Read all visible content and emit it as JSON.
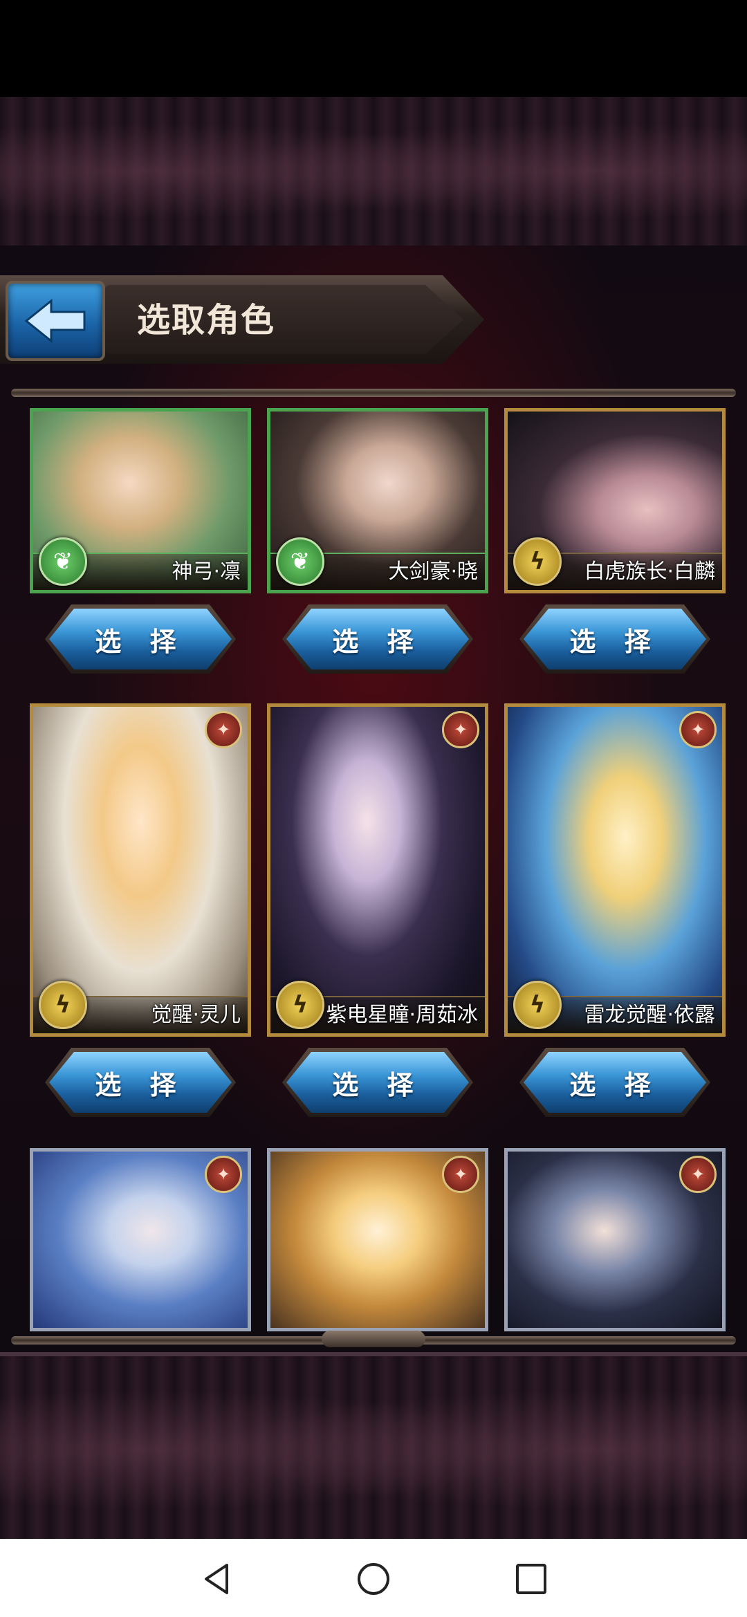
{
  "header": {
    "title": "选取角色"
  },
  "buttons": {
    "select_label": "选 择"
  },
  "characters": [
    {
      "name": "神弓·凛",
      "element": "leaf-icon",
      "frame": "green"
    },
    {
      "name": "大剑豪·晓",
      "element": "leaf-icon",
      "frame": "green"
    },
    {
      "name": "白虎族长·白麟",
      "element": "thunder-icon",
      "frame": "gold"
    },
    {
      "name": "觉醒·灵儿",
      "element": "thunder-icon",
      "frame": "gold"
    },
    {
      "name": "紫电星瞳·周茹冰",
      "element": "thunder-icon",
      "frame": "gold"
    },
    {
      "name": "雷龙觉醒·依露",
      "element": "thunder-icon",
      "frame": "gold"
    },
    {
      "name": "",
      "element": "",
      "frame": "silver"
    },
    {
      "name": "",
      "element": "",
      "frame": "silver"
    },
    {
      "name": "",
      "element": "",
      "frame": "silver"
    }
  ],
  "colors": {
    "accent_blue": "#2b7fc2",
    "frame_gold": "#b48a3c",
    "frame_green": "#49a34f",
    "background": "#120a12"
  }
}
